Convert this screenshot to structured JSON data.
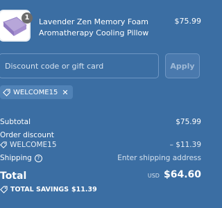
{
  "product": {
    "quantity": "1",
    "name": "Lavender Zen Memory Foam Aromatherapy Cooling Pillow",
    "price": "$75.99"
  },
  "discount": {
    "placeholder": "Discount code or gift card",
    "apply_label": "Apply",
    "applied_code": "WELCOME15"
  },
  "summary": {
    "subtotal_label": "Subtotal",
    "subtotal_value": "$75.99",
    "order_discount_label": "Order discount",
    "discount_code": "WELCOME15",
    "discount_value": "– $11.39",
    "shipping_label": "Shipping",
    "shipping_value": "Enter shipping address",
    "total_label": "Total",
    "total_currency": "USD",
    "total_value": "$64.60",
    "savings_label": "TOTAL SAVINGS",
    "savings_value": "$11.39"
  }
}
